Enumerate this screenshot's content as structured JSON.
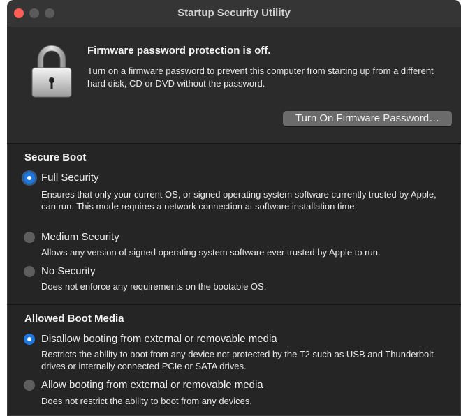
{
  "window": {
    "title": "Startup Security Utility",
    "controls": [
      "close",
      "minimize",
      "zoom"
    ]
  },
  "firmware": {
    "heading": "Firmware password protection is off.",
    "description": "Turn on a firmware password to prevent this computer from starting up from a different hard disk, CD or DVD without the password.",
    "button_label": "Turn On Firmware Password…",
    "icon": "lock-icon"
  },
  "secure_boot": {
    "title": "Secure Boot",
    "options": [
      {
        "label": "Full Security",
        "description": "Ensures that only your current OS, or signed operating system software currently trusted by Apple, can run. This mode requires a network connection at software installation time.",
        "selected": true
      },
      {
        "label": "Medium Security",
        "description": "Allows any version of signed operating system software ever trusted by Apple to run.",
        "selected": false
      },
      {
        "label": "No Security",
        "description": "Does not enforce any requirements on the bootable OS.",
        "selected": false
      }
    ]
  },
  "boot_media": {
    "title": "Allowed Boot Media",
    "options": [
      {
        "label": "Disallow booting from external or removable media",
        "description": "Restricts the ability to boot from any device not protected by the T2 such as USB and Thunderbolt drives or internally connected PCIe or SATA drives.",
        "selected": true
      },
      {
        "label": "Allow booting from external or removable media",
        "description": "Does not restrict the ability to boot from any devices.",
        "selected": false
      }
    ]
  },
  "colors": {
    "accent": "#1f78e0",
    "window_bg": "#252525",
    "titlebar_bg": "#353535",
    "close_button": "#ff5f57"
  }
}
